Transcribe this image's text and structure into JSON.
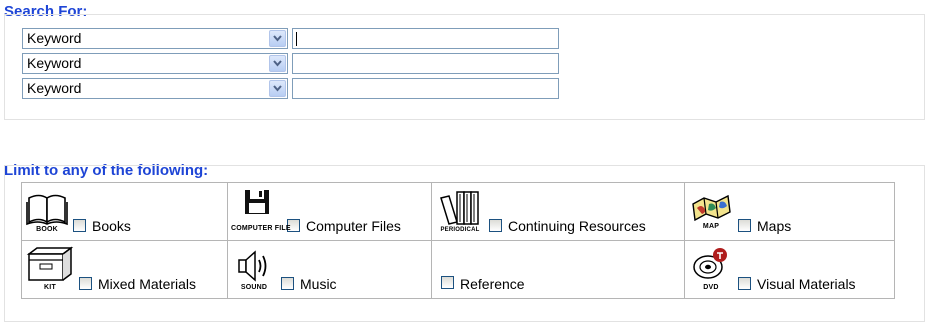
{
  "search": {
    "heading": "Search For:",
    "rows": [
      {
        "field": "Keyword",
        "value": ""
      },
      {
        "field": "Keyword",
        "value": ""
      },
      {
        "field": "Keyword",
        "value": ""
      }
    ]
  },
  "limits": {
    "heading": "Limit to any of the following:",
    "items": [
      {
        "label": "Books",
        "icon_name": "book-icon",
        "icon_caption": "BOOK",
        "checked": false
      },
      {
        "label": "Computer Files",
        "icon_name": "floppy-disk-icon",
        "icon_caption": "COMPUTER FILE",
        "checked": false
      },
      {
        "label": "Continuing Resources",
        "icon_name": "periodical-icon",
        "icon_caption": "PERIODICAL",
        "checked": false
      },
      {
        "label": "Maps",
        "icon_name": "map-icon",
        "icon_caption": "MAP",
        "checked": false
      },
      {
        "label": "Mixed Materials",
        "icon_name": "kit-box-icon",
        "icon_caption": "KIT",
        "checked": false
      },
      {
        "label": "Music",
        "icon_name": "speaker-icon",
        "icon_caption": "SOUND",
        "checked": false
      },
      {
        "label": "Reference",
        "icon_name": "",
        "icon_caption": "",
        "checked": false
      },
      {
        "label": "Visual Materials",
        "icon_name": "dvd-icon",
        "icon_caption": "DVD",
        "checked": false
      }
    ]
  },
  "colors": {
    "heading": "#1e45d6",
    "field_border": "#7f9db9",
    "checkbox_border": "#1c5180"
  }
}
